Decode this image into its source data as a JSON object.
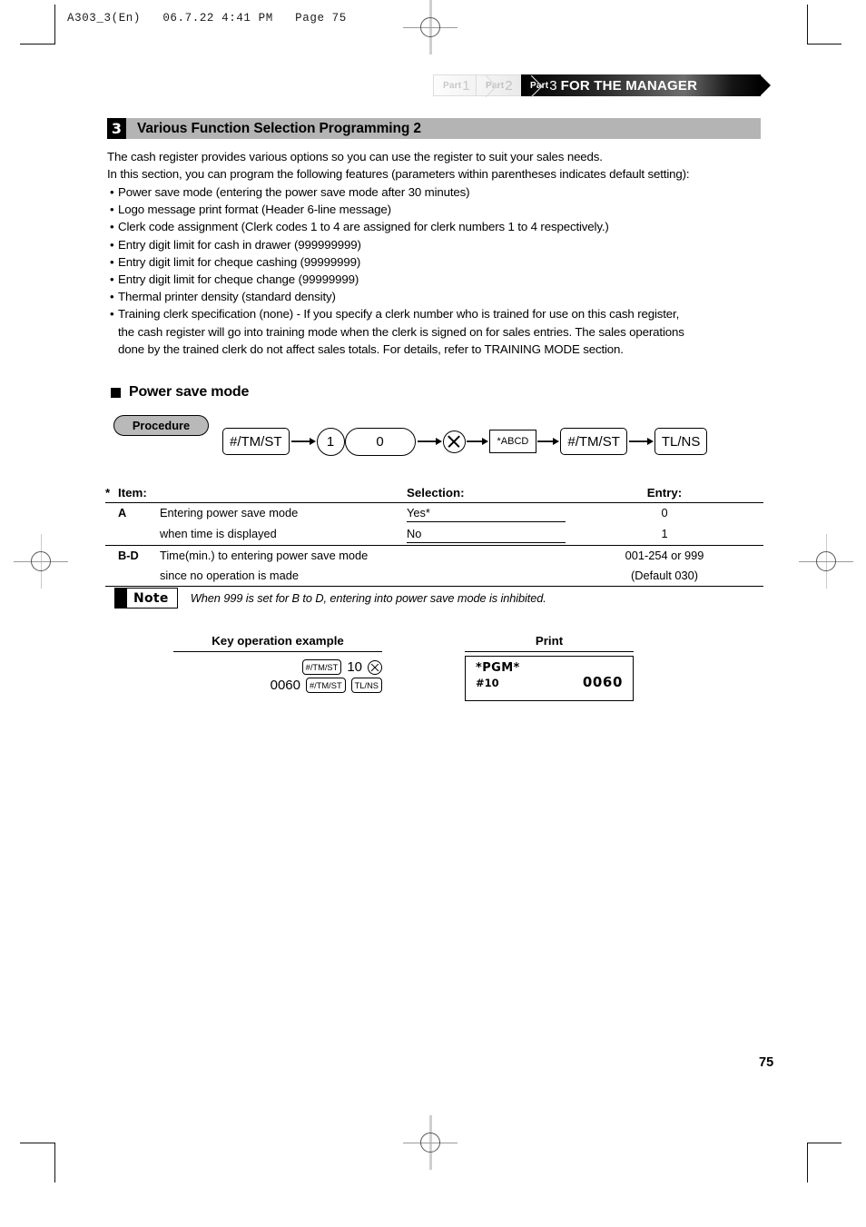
{
  "print_header": "A303_3(En)   06.7.22 4:41 PM   Page 75",
  "banner": {
    "part1_small": "Part",
    "part1_num": "1",
    "part2_small": "Part",
    "part2_num": "2",
    "part3_small": "Part",
    "part3_num": "3",
    "part3_title": "FOR THE MANAGER"
  },
  "section": {
    "number": "3",
    "title": "Various Function Selection Programming 2"
  },
  "intro": {
    "line1": "The cash register provides various options so you can use the register to suit your sales needs.",
    "line2": "In this section, you can program the following features (parameters within parentheses indicates default setting):"
  },
  "bullets": [
    {
      "text": "Power save mode (entering the power save mode after 30 minutes)"
    },
    {
      "text": "Logo message print format (Header 6-line message)"
    },
    {
      "text": "Clerk code assignment (Clerk codes 1 to 4 are assigned for clerk numbers 1 to 4 respectively.)"
    },
    {
      "text": "Entry digit limit for cash in drawer (999999999)"
    },
    {
      "text": "Entry digit limit for cheque cashing (99999999)"
    },
    {
      "text": "Entry digit limit for cheque change (99999999)"
    },
    {
      "text": "Thermal printer density (standard density)"
    },
    {
      "text": "Training clerk specification (none) - If you specify a clerk number who is trained for use on this cash register,"
    }
  ],
  "bullet_continuations": [
    "the cash register will go into training mode when the clerk is signed on for sales entries.  The sales operations",
    "done by the trained clerk do not affect sales totals.  For details, refer to TRAINING MODE section."
  ],
  "power_save": {
    "heading": "Power save mode",
    "procedure_label": "Procedure",
    "flow": [
      {
        "type": "key-rect",
        "label": "#/TM/ST"
      },
      {
        "type": "circle",
        "label": "1"
      },
      {
        "type": "pill",
        "label": "0"
      },
      {
        "type": "x-circle",
        "label": "X"
      },
      {
        "type": "square-box",
        "label": "*ABCD"
      },
      {
        "type": "key-rect",
        "label": "#/TM/ST"
      },
      {
        "type": "key-rect",
        "label": "TL/NS"
      }
    ]
  },
  "spec_table": {
    "star": "*",
    "headers": {
      "item": "Item:",
      "selection": "Selection:",
      "entry": "Entry:"
    },
    "rows": [
      {
        "key": "A",
        "item_line1": "Entering power save mode",
        "item_line2": "when time is displayed",
        "sel_line1": "Yes*",
        "sel_line2": "No",
        "ent_line1": "0",
        "ent_line2": "1"
      },
      {
        "key": "B-D",
        "item_line1": "Time(min.) to entering power save mode",
        "item_line2": "since no operation is made",
        "sel_line1": "",
        "sel_line2": "",
        "ent_line1": "001-254 or 999",
        "ent_line2": "(Default 030)"
      }
    ]
  },
  "note": {
    "label": "Note",
    "text": "When 999 is set for B to D, entering into power save mode is inhibited."
  },
  "example": {
    "key_op_heading": "Key operation example",
    "print_heading": "Print",
    "line1": {
      "key1": "#/TM/ST",
      "value": "10",
      "key_x": "X"
    },
    "line2": {
      "value": "0060",
      "key1": "#/TM/ST",
      "key2": "TL/NS"
    },
    "receipt": {
      "title": "*PGM*",
      "code": "#10",
      "amount": "0060"
    }
  },
  "page_number": "75"
}
